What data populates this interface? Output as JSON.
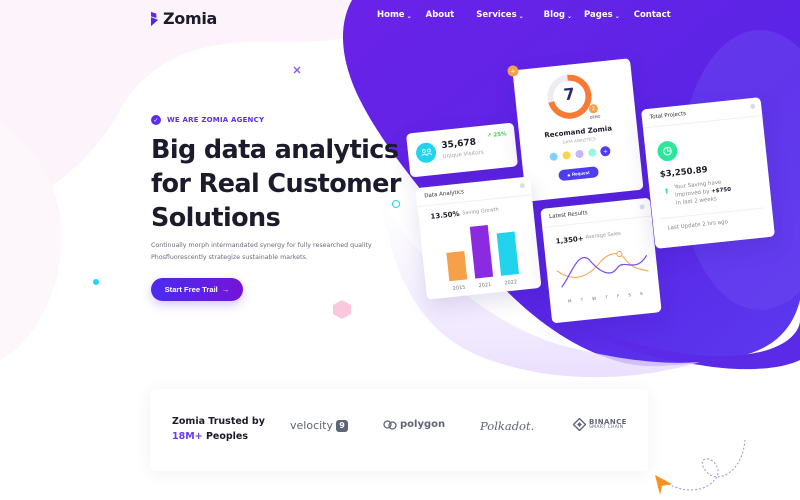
{
  "header": {
    "logo_text": "Zomia",
    "nav": [
      {
        "label": "Home",
        "has_dropdown": true
      },
      {
        "label": "About",
        "has_dropdown": false
      },
      {
        "label": "Services",
        "has_dropdown": true
      },
      {
        "label": "Blog",
        "has_dropdown": true
      },
      {
        "label": "Pages",
        "has_dropdown": true
      },
      {
        "label": "Contact",
        "has_dropdown": false
      }
    ],
    "dropdown_glyph": "⌄"
  },
  "hero": {
    "tagline_icon": "check-circle-icon",
    "tagline": "WE ARE ZOMIA AGENCY",
    "headline_lines": [
      "Big data analytics",
      "for Real Customer",
      "Solutions"
    ],
    "description_lines": [
      "Continually morph intermandated synergy for fully researched quality",
      "Phosfluorescently strategize sustainable markets."
    ],
    "cta_label": "Start Free Trail",
    "cta_arrow": "→"
  },
  "cards": {
    "visitors": {
      "value": "35,678",
      "label": "Unique Visitors",
      "change": "↗ 25%",
      "icon": "users-icon"
    },
    "recommend": {
      "score": "7",
      "badge": "2",
      "badge_caption": "DEMO",
      "title": "Recomand Zomia",
      "subtitle": "DATA ANALYTICS",
      "add_badge": "+",
      "avatar_more": "+",
      "button_label": "Request",
      "button_icon": "lock-icon",
      "progress_fraction": 0.72
    },
    "data_analytics": {
      "title": "Data Analytics",
      "value": "13.50%",
      "label": "Saving Growth",
      "bars": [
        {
          "year": "2015",
          "value": 0.55,
          "color": "#f7a04a"
        },
        {
          "year": "2021",
          "value": 1.0,
          "color": "#8a2be2"
        },
        {
          "year": "2022",
          "value": 0.82,
          "color": "#22d3ee"
        }
      ]
    },
    "latest_results": {
      "title": "Latest Results",
      "value": "1,350+",
      "label": "Average Sales",
      "days": [
        "M",
        "T",
        "W",
        "T",
        "F",
        "S",
        "S"
      ]
    },
    "total_projects": {
      "title": "Total Projects",
      "amount": "$3,250.89",
      "saving_lines": [
        "Your Saving have",
        "improved by",
        "in last 2 weeks"
      ],
      "saving_value": "+$750",
      "footer": "Last Update 2 hrs ago"
    }
  },
  "trusted": {
    "line1": "Zomia Trusted by",
    "highlight": "18M+",
    "line2_rest": " Peoples",
    "brands": [
      {
        "name": "velocity",
        "badge": "9"
      },
      {
        "name": "polygon"
      },
      {
        "name": "Polkadot."
      },
      {
        "name": "BINANCE",
        "sub": "SMART CHAIN"
      }
    ]
  },
  "colors": {
    "primary": "#5c2ee6",
    "purple_bg": "#5a1fe0",
    "orange": "#f7a04a",
    "cyan": "#22d3ee",
    "green": "#2ee59d"
  }
}
